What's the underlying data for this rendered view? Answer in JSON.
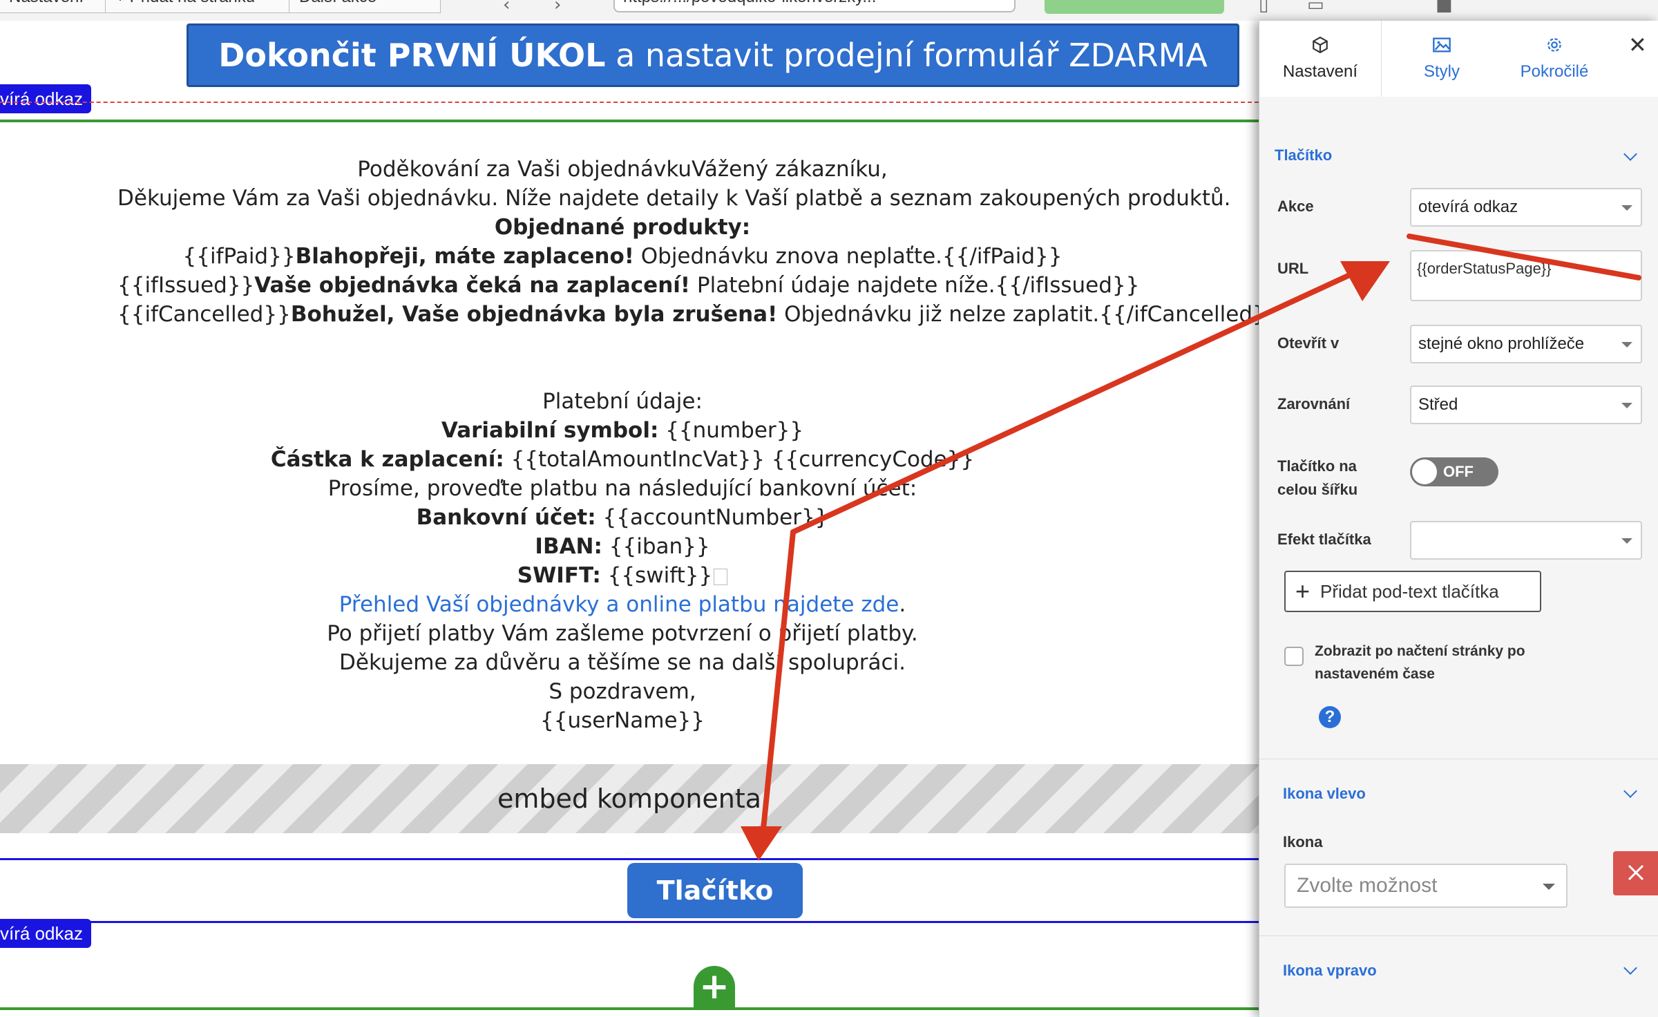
{
  "browser": {
    "tab_1": "Nastavení",
    "tab_2": "+ Přidat na stránku",
    "tab_3": "Další akce",
    "url": "https://.../povodquiko-likonverzky..."
  },
  "canvas": {
    "banner_bold": "Dokončit PRVNÍ ÚKOL",
    "banner_rest": " a nastavit prodejní formulář ZDARMA",
    "tag_top": "vírá odkaz",
    "tag_bottom": "vírá odkaz",
    "lines": {
      "l1": "Poděkování za Vaši objednávkuVážený zákazníku,",
      "l2": "Děkujeme Vám za Vaši objednávku. Níže najdete detaily k Vaší platbě a seznam zakoupených produktů.",
      "l3_b": "Objednané produkty:",
      "l4_a": "{{ifPaid}}",
      "l4_b": "Blahopřeji, máte zaplaceno!",
      "l4_c": " Objednávku znova neplaťte.{{/ifPaid}}",
      "l5_a": "{{ifIssued}}",
      "l5_b": "Vaše objednávka čeká na zaplacení!",
      "l5_c": " Platební údaje najdete níže.{{/ifIssued}}",
      "l6_a": "{{ifCancelled}}",
      "l6_b": "Bohužel, Vaše objednávka byla zrušena!",
      "l6_c": " Objednávku již nelze zaplatit.{{/ifCancelled}}",
      "l7": "Platební údaje:",
      "l8_b": "Variabilní symbol:",
      "l8_c": " {{number}}",
      "l9_b": "Částka k zaplacení:",
      "l9_c": " {{totalAmountIncVat}} {{currencyCode}}",
      "l10": "Prosíme, proveďte platbu na následující bankovní účet:",
      "l11_b": "Bankovní účet:",
      "l11_c": " {{accountNumber}}",
      "l12_b": "IBAN:",
      "l12_c": " {{iban}}",
      "l13_b": "SWIFT:",
      "l13_c": " {{swift}}",
      "l14_link": "Přehled Vaší objednávky a online platbu najdete zde",
      "l14_dot": ".",
      "l15": "Po přijetí platby Vám zašleme potvrzení o přijetí platby.",
      "l16": "Děkujeme za důvěru a těšíme se na další spolupráci.",
      "l17": "S pozdravem,",
      "l18": "{{userName}}"
    },
    "embed_label": "embed komponenta",
    "button_label": "Tlačítko",
    "add_glyph": "+"
  },
  "panel": {
    "tabs": [
      {
        "label": "Nastavení",
        "icon": "cube-icon"
      },
      {
        "label": "Styly",
        "icon": "image-icon"
      },
      {
        "label": "Pokročilé",
        "icon": "gear-icon"
      }
    ],
    "close_glyph": "✕",
    "section_button": "Tlačítko",
    "fields": {
      "akce_label": "Akce",
      "akce_value": "otevírá odkaz",
      "url_label": "URL",
      "url_value": "{{orderStatusPage}}",
      "otevrit_label": "Otevřít v",
      "otevrit_value": "stejné okno prohlížeče",
      "zarovnani_label": "Zarovnání",
      "zarovnani_value": "Střed",
      "fullwidth_label_1": "Tlačítko na",
      "fullwidth_label_2": "celou šířku",
      "fullwidth_value": "OFF",
      "efekt_label": "Efekt tlačítka",
      "efekt_value": ""
    },
    "add_subtext": "Přidat pod-text tlačítka",
    "add_subtext_glyph": "+",
    "show_after_time": "Zobrazit po načtení stránky po nastaveném čase",
    "help_glyph": "?",
    "section_icon_left": "Ikona vlevo",
    "icon_label": "Ikona",
    "icon_placeholder": "Zvolte možnost",
    "section_icon_right": "Ikona vpravo"
  },
  "colors": {
    "accent_blue": "#2f6fcd",
    "tag_blue": "#1a14e0",
    "green": "#3a9a32",
    "annotation_red": "#d9361f",
    "delete_red": "#d9534f"
  }
}
